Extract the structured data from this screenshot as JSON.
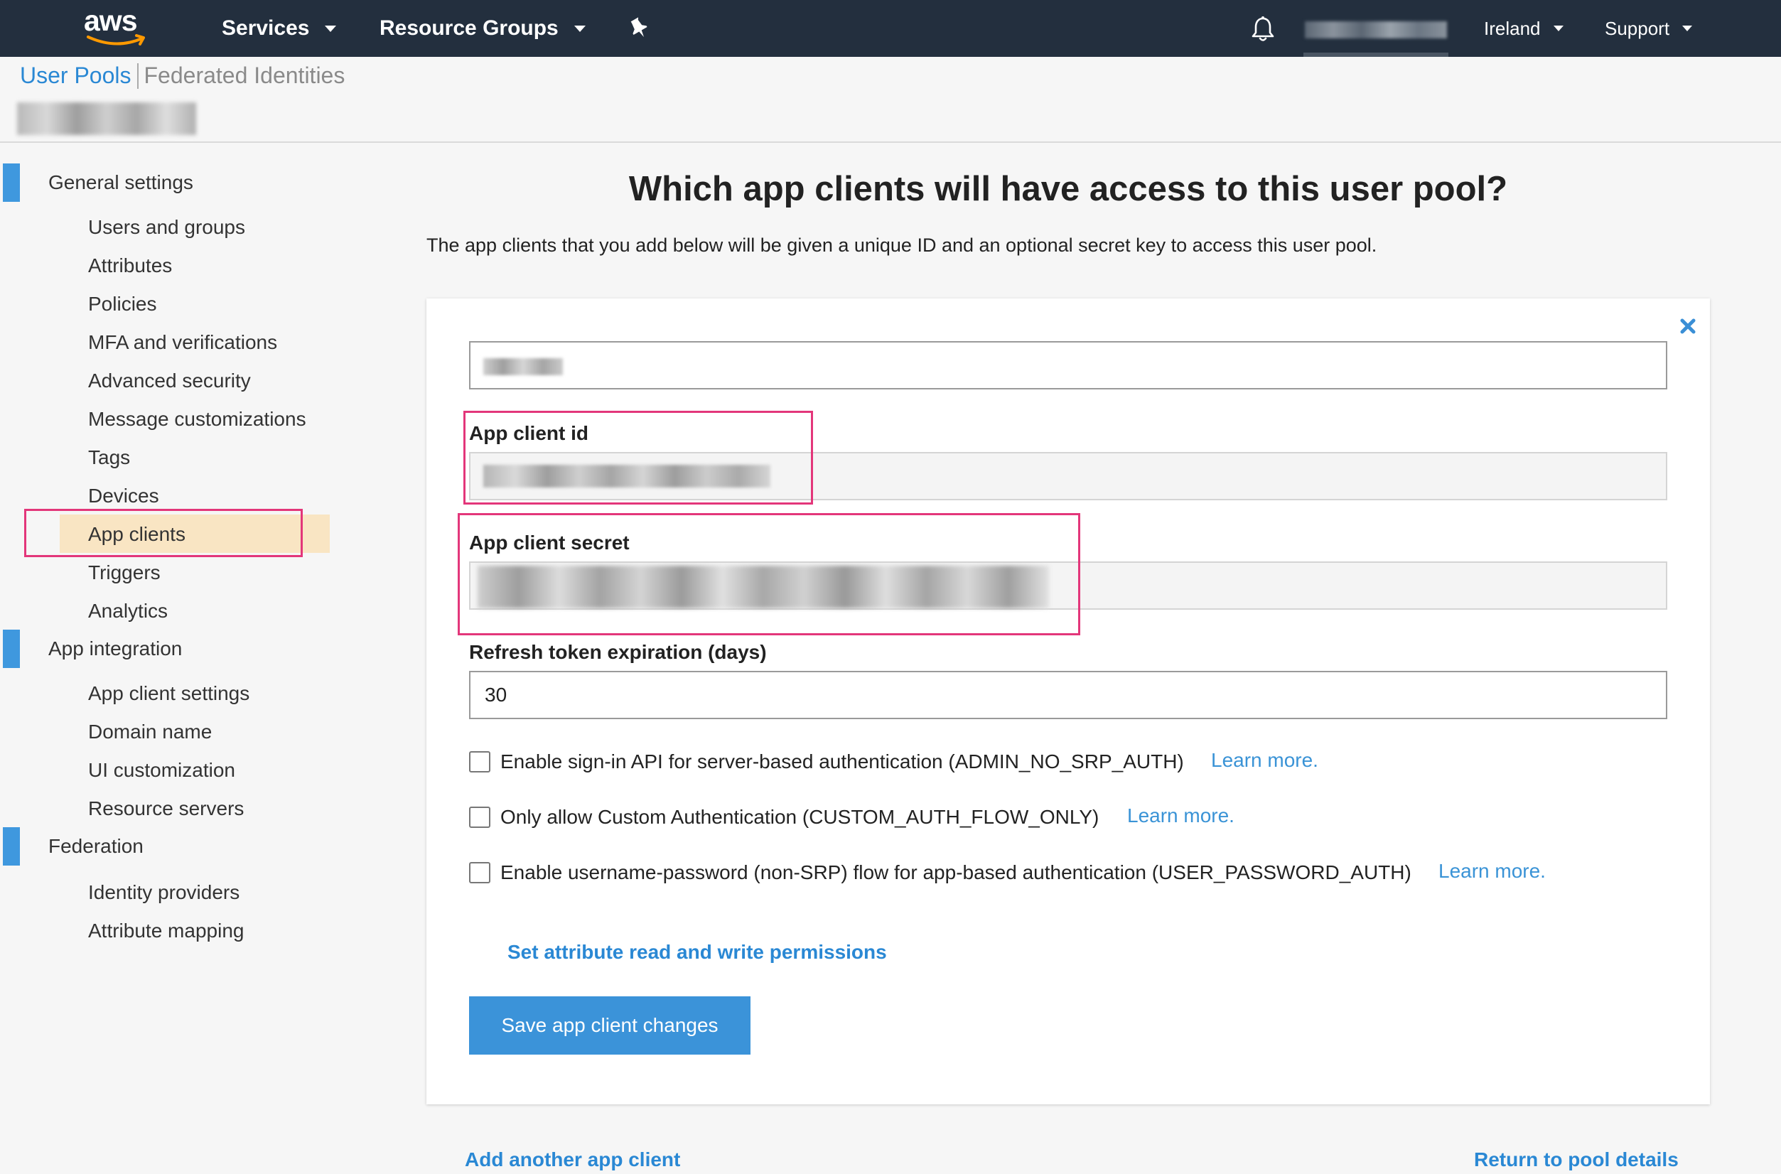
{
  "topbar": {
    "logo": "aws",
    "services_label": "Services",
    "resource_groups_label": "Resource Groups",
    "region_label": "Ireland",
    "support_label": "Support",
    "icons": [
      "pin-icon",
      "bell-icon"
    ]
  },
  "breadcrumb": {
    "user_pools": "User Pools",
    "federated_identities": "Federated Identities"
  },
  "sidebar": {
    "sections": [
      {
        "label": "General settings",
        "items": [
          "Users and groups",
          "Attributes",
          "Policies",
          "MFA and verifications",
          "Advanced security",
          "Message customizations",
          "Tags",
          "Devices",
          "App clients",
          "Triggers",
          "Analytics"
        ]
      },
      {
        "label": "App integration",
        "items": [
          "App client settings",
          "Domain name",
          "UI customization",
          "Resource servers"
        ]
      },
      {
        "label": "Federation",
        "items": [
          "Identity providers",
          "Attribute mapping"
        ]
      }
    ],
    "active_item": "App clients"
  },
  "main": {
    "title": "Which app clients will have access to this user pool?",
    "description": "The app clients that you add below will be given a unique ID and an optional secret key to access this user pool.",
    "app_client_id_label": "App client id",
    "app_client_secret_label": "App client secret",
    "refresh_label": "Refresh token expiration (days)",
    "refresh_value": "30",
    "checkboxes": [
      {
        "label": "Enable sign-in API for server-based authentication (ADMIN_NO_SRP_AUTH)",
        "checked": false,
        "link": "Learn more."
      },
      {
        "label": "Only allow Custom Authentication (CUSTOM_AUTH_FLOW_ONLY)",
        "checked": false,
        "link": "Learn more."
      },
      {
        "label": "Enable username-password (non-SRP) flow for app-based authentication (USER_PASSWORD_AUTH)",
        "checked": false,
        "link": "Learn more."
      }
    ],
    "permissions_link": "Set attribute read and write permissions",
    "save_button": "Save app client changes",
    "add_another": "Add another app client",
    "return_link": "Return to pool details"
  },
  "colors": {
    "topbar": "#232f3e",
    "link": "#2a88d4",
    "button": "#3b93d9",
    "sidebar_marker": "#3f98de",
    "active_item_bg": "#f9e5c3",
    "highlight": "#e3367a"
  }
}
